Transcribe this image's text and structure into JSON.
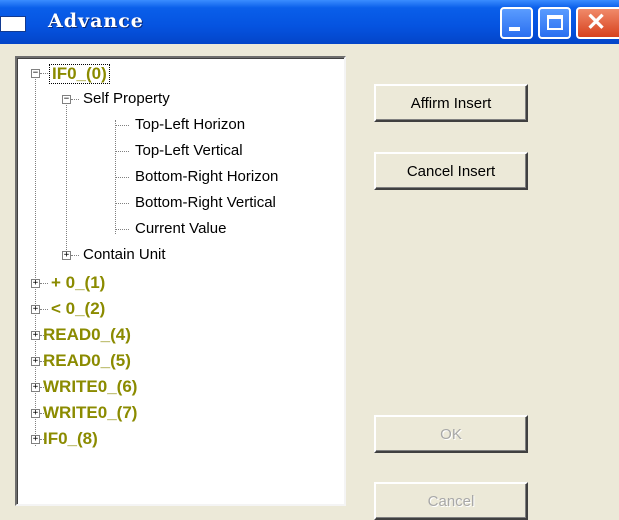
{
  "window": {
    "title": "Advance"
  },
  "tree": {
    "root": {
      "label": "IF0_(0)",
      "expanded": true
    },
    "self_property": {
      "label": "Self Property",
      "expanded": true
    },
    "properties": [
      "Top-Left Horizon",
      "Top-Left Vertical",
      "Bottom-Right Horizon",
      "Bottom-Right Vertical",
      "Current Value"
    ],
    "contain_unit": {
      "label": "Contain Unit",
      "expanded": false
    },
    "siblings": [
      "+ 0_(1)",
      "< 0_(2)",
      "READ0_(4)",
      "READ0_(5)",
      "WRITE0_(6)",
      "WRITE0_(7)",
      "IF0_(8)"
    ]
  },
  "buttons": {
    "affirm_insert": "Affirm Insert",
    "cancel_insert": "Cancel Insert",
    "ok": "OK",
    "cancel": "Cancel"
  },
  "colors": {
    "titlebar": "#0553e0",
    "node_highlight": "#8b8b00",
    "dialog_bg": "#ece9d8"
  }
}
